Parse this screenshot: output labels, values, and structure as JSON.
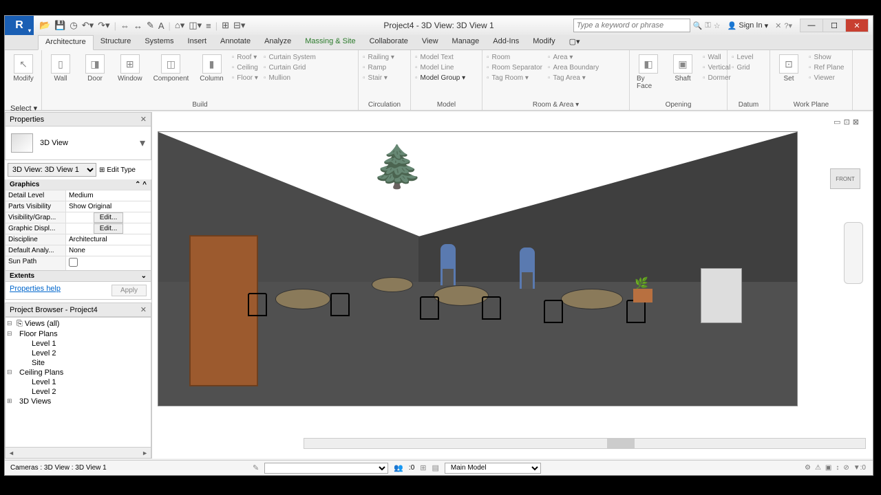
{
  "title": "Project4 - 3D View: 3D View 1",
  "search_placeholder": "Type a keyword or phrase",
  "sign_in": "Sign In",
  "tabs": [
    "Architecture",
    "Structure",
    "Systems",
    "Insert",
    "Annotate",
    "Analyze",
    "Massing & Site",
    "Collaborate",
    "View",
    "Manage",
    "Add-Ins",
    "Modify"
  ],
  "ribbon": {
    "select": {
      "modify": "Modify",
      "label": "Select ▾"
    },
    "build": {
      "label": "Build",
      "big": [
        "Wall",
        "Door",
        "Window",
        "Component",
        "Column"
      ],
      "col1": [
        "Roof  ▾",
        "Ceiling",
        "Floor  ▾"
      ],
      "col2": [
        "Curtain System",
        "Curtain Grid",
        "Mullion"
      ]
    },
    "circulation": {
      "label": "Circulation",
      "items": [
        "Railing  ▾",
        "Ramp",
        "Stair  ▾"
      ]
    },
    "model": {
      "label": "Model",
      "items": [
        "Model Text",
        "Model Line",
        "Model Group ▾"
      ]
    },
    "room": {
      "label": "Room & Area  ▾",
      "c1": [
        "Room",
        "Room Separator",
        "Tag Room  ▾"
      ],
      "c2": [
        "Area  ▾",
        "Area Boundary",
        "Tag Area  ▾"
      ]
    },
    "opening": {
      "label": "Opening",
      "big": [
        "By Face",
        "Shaft"
      ],
      "items": [
        "Wall",
        "Vertical",
        "Dormer"
      ]
    },
    "datum": {
      "label": "Datum",
      "items": [
        "Level",
        "Grid"
      ]
    },
    "workplane": {
      "label": "Work Plane",
      "big": [
        "Set"
      ],
      "items": [
        "Show",
        "Ref Plane",
        "Viewer"
      ]
    }
  },
  "properties": {
    "title": "Properties",
    "type_name": "3D View",
    "selector": "3D View: 3D View 1",
    "edit_type": "Edit Type",
    "group": "Graphics",
    "rows": [
      {
        "k": "Detail Level",
        "v": "Medium"
      },
      {
        "k": "Parts Visibility",
        "v": "Show Original"
      },
      {
        "k": "Visibility/Grap...",
        "v": "Edit...",
        "btn": true
      },
      {
        "k": "Graphic Displ...",
        "v": "Edit...",
        "btn": true
      },
      {
        "k": "Discipline",
        "v": "Architectural"
      },
      {
        "k": "Default Analy...",
        "v": "None"
      },
      {
        "k": "Sun Path",
        "v": "",
        "check": true
      }
    ],
    "extents": "Extents",
    "help": "Properties help",
    "apply": "Apply"
  },
  "browser": {
    "title": "Project Browser - Project4",
    "root": "Views (all)",
    "floor_plans": "Floor Plans",
    "fp_items": [
      "Level 1",
      "Level 2",
      "Site"
    ],
    "ceiling_plans": "Ceiling Plans",
    "cp_items": [
      "Level 1",
      "Level 2"
    ],
    "views3d": "3D Views"
  },
  "navcube": "FRONT",
  "status": {
    "left": "Cameras : 3D View : 3D View 1",
    "zero": ":0",
    "workset": "Main Model"
  }
}
